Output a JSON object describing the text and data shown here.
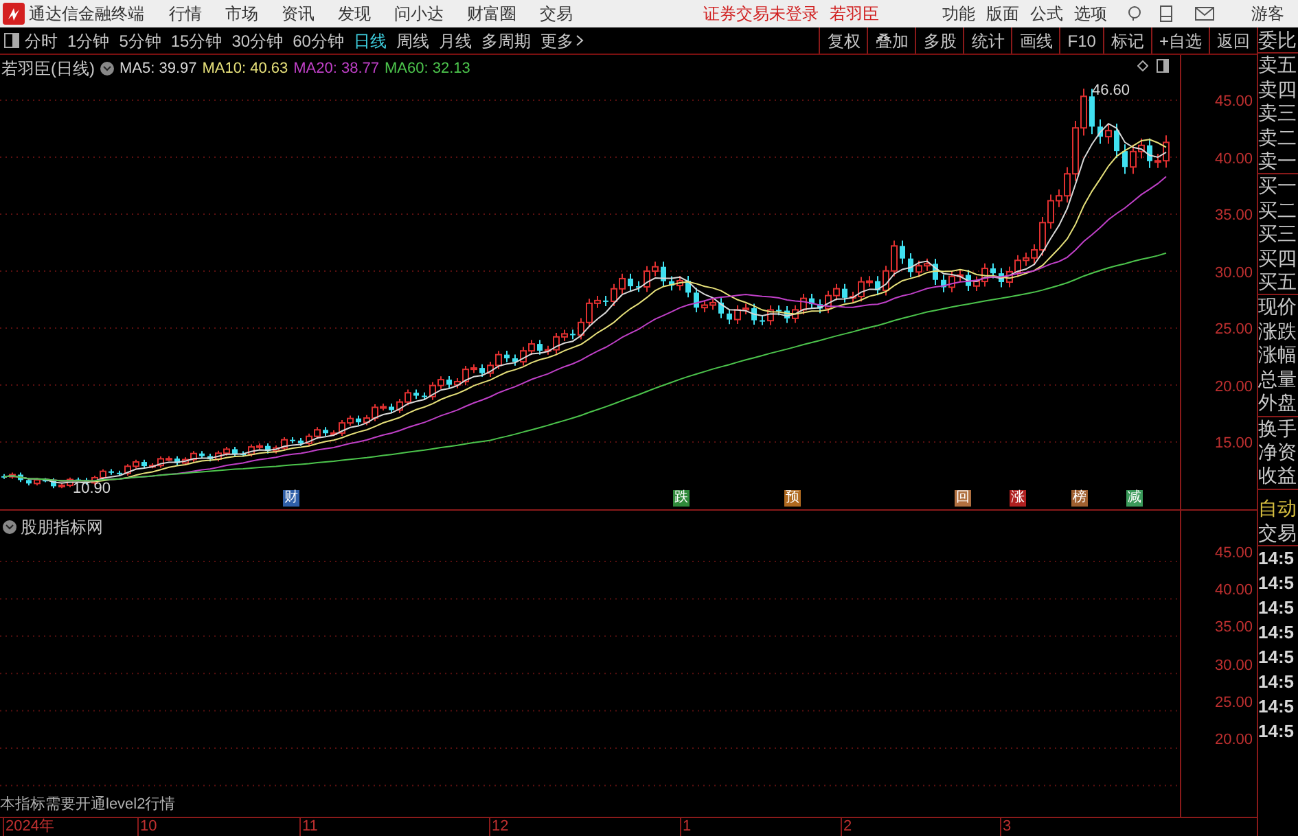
{
  "menu_bar": {
    "app_title": "通达信金融终端",
    "menus": [
      "行情",
      "市场",
      "资讯",
      "发现",
      "问小达",
      "财富圈",
      "交易"
    ],
    "login_status": "证券交易未登录",
    "stock_name": "若羽臣",
    "tools": [
      "功能",
      "版面",
      "公式",
      "选项"
    ],
    "user": "游客"
  },
  "period_tabs": [
    {
      "label": "分时",
      "selected": false
    },
    {
      "label": "1分钟",
      "selected": false
    },
    {
      "label": "5分钟",
      "selected": false
    },
    {
      "label": "15分钟",
      "selected": false
    },
    {
      "label": "30分钟",
      "selected": false
    },
    {
      "label": "60分钟",
      "selected": false
    },
    {
      "label": "日线",
      "selected": true
    },
    {
      "label": "周线",
      "selected": false
    },
    {
      "label": "月线",
      "selected": false
    },
    {
      "label": "多周期",
      "selected": false
    },
    {
      "label": "更多",
      "selected": false
    }
  ],
  "toolbar_buttons": [
    "复权",
    "叠加",
    "多股",
    "统计",
    "画线",
    "F10",
    "标记",
    "+自选",
    "返回"
  ],
  "main_chart": {
    "title": "若羽臣(日线)",
    "indicators": [
      {
        "label": "MA5: 39.97",
        "color": "#d8d8d8"
      },
      {
        "label": "MA10: 40.63",
        "color": "#e6e07a"
      },
      {
        "label": "MA20: 38.77",
        "color": "#c040c8"
      },
      {
        "label": "MA60: 32.13",
        "color": "#4cc44c"
      }
    ],
    "high_label": "46.60",
    "low_label": "10.90",
    "y_axis": [
      "45.00",
      "40.00",
      "35.00",
      "30.00",
      "25.00",
      "20.00",
      "15.00"
    ],
    "signals": [
      {
        "label": "财",
        "color": "#2f5fa8"
      },
      {
        "label": "跌",
        "color": "#2f8a3a"
      },
      {
        "label": "预",
        "color": "#b06a20"
      },
      {
        "label": "回",
        "color": "#b07040"
      },
      {
        "label": "涨",
        "color": "#b02020"
      },
      {
        "label": "榜",
        "color": "#a06030"
      },
      {
        "label": "减",
        "color": "#3a9a5a"
      }
    ]
  },
  "indicator_panel": {
    "title": "股朋指标网",
    "y_axis": [
      "45.00",
      "40.00",
      "35.00",
      "30.00",
      "25.00",
      "20.00"
    ],
    "notice": "本指标需要开通level2行情"
  },
  "x_axis": [
    "2024年",
    "10",
    "11",
    "12",
    "1",
    "2",
    "3"
  ],
  "quote_panel": {
    "groups": [
      [
        "委比"
      ],
      [
        "卖五",
        "卖四",
        "卖三",
        "卖二",
        "卖一"
      ],
      [
        "买一",
        "买二",
        "买三",
        "买四",
        "买五"
      ],
      [
        "现价",
        "涨跌",
        "涨幅",
        "总量",
        "外盘"
      ],
      [
        "换手",
        "净资",
        "收益"
      ]
    ],
    "auto_label": "自动",
    "trade_label": "交易",
    "times": [
      "14:5",
      "14:5",
      "14:5",
      "14:5",
      "14:5",
      "14:5",
      "14:5",
      "14:5"
    ]
  }
}
